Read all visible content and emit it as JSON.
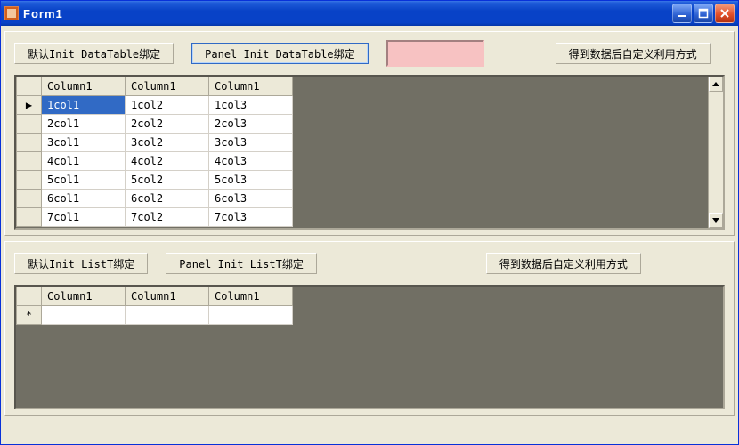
{
  "window": {
    "title": "Form1"
  },
  "topButtons": {
    "b1": "默认Init DataTable绑定",
    "b2": "Panel Init DataTable绑定",
    "b3": "得到数据后自定义利用方式"
  },
  "grid1": {
    "headers": [
      "Column1",
      "Column1",
      "Column1"
    ],
    "rows": [
      {
        "selected": true,
        "cells": [
          "1col1",
          "1col2",
          "1col3"
        ]
      },
      {
        "selected": false,
        "cells": [
          "2col1",
          "2col2",
          "2col3"
        ]
      },
      {
        "selected": false,
        "cells": [
          "3col1",
          "3col2",
          "3col3"
        ]
      },
      {
        "selected": false,
        "cells": [
          "4col1",
          "4col2",
          "4col3"
        ]
      },
      {
        "selected": false,
        "cells": [
          "5col1",
          "5col2",
          "5col3"
        ]
      },
      {
        "selected": false,
        "cells": [
          "6col1",
          "6col2",
          "6col3"
        ]
      },
      {
        "selected": false,
        "cells": [
          "7col1",
          "7col2",
          "7col3"
        ]
      }
    ],
    "rowIndicator": "▶"
  },
  "bottomButtons": {
    "b1": "默认Init ListT绑定",
    "b2": "Panel Init ListT绑定",
    "b3": "得到数据后自定义利用方式"
  },
  "grid2": {
    "headers": [
      "Column1",
      "Column1",
      "Column1"
    ],
    "newRowIndicator": "*"
  }
}
